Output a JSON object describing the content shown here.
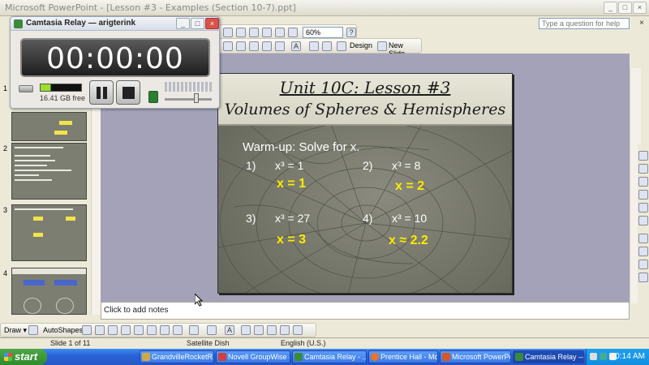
{
  "ppt": {
    "title": "Microsoft PowerPoint - [Lesson #3 - Examples (Section 10-7).ppt]",
    "help_placeholder": "Type a question for help",
    "zoom": "60%",
    "design_label": "Design",
    "new_slide_label": "New Slide",
    "notes_placeholder": "Click to add notes",
    "thumbnails": [
      "1",
      "2",
      "3",
      "4"
    ]
  },
  "slide": {
    "title": "Unit 10C:  Lesson #3",
    "subtitle": "Volumes of Spheres & Hemispheres",
    "warmup": "Warm-up:  Solve for x.",
    "problems": [
      {
        "num": "1)",
        "eq": "x³ = 1",
        "answer": "x = 1"
      },
      {
        "num": "2)",
        "eq": "x³ = 8",
        "answer": "x = 2"
      },
      {
        "num": "3)",
        "eq": "x³ = 27",
        "answer": "x = 3"
      },
      {
        "num": "4)",
        "eq": "x³ = 10",
        "answer": "x ≈ 2.2"
      }
    ]
  },
  "draw_toolbar": {
    "draw_label": "Draw ▾",
    "autoshapes_label": "AutoShapes ▾"
  },
  "status": {
    "slide_count": "Slide 1 of 11",
    "template": "Satellite Dish",
    "language": "English (U.S.)"
  },
  "taskbar": {
    "start_label": "start",
    "items": [
      {
        "label": "GrandvilleRocketR...",
        "color": "#cfa84a"
      },
      {
        "label": "Novell GroupWise -...",
        "color": "#d04040"
      },
      {
        "label": "Camtasia Relay - ...",
        "color": "#3a8a3a"
      },
      {
        "label": "Prentice Hall - Mozil...",
        "color": "#e8742a"
      },
      {
        "label": "Microsoft PowerPoi...",
        "color": "#d5572a"
      },
      {
        "label": "Camtasia Relay — ...",
        "color": "#3a8a3a"
      }
    ],
    "clock": "10:14 AM"
  },
  "relay": {
    "title": "Camtasia Relay — arigterink",
    "timer": "00:00:00",
    "free_space": "16.41 GB free",
    "audio_level": 0.25,
    "volume_level": 0.7
  }
}
